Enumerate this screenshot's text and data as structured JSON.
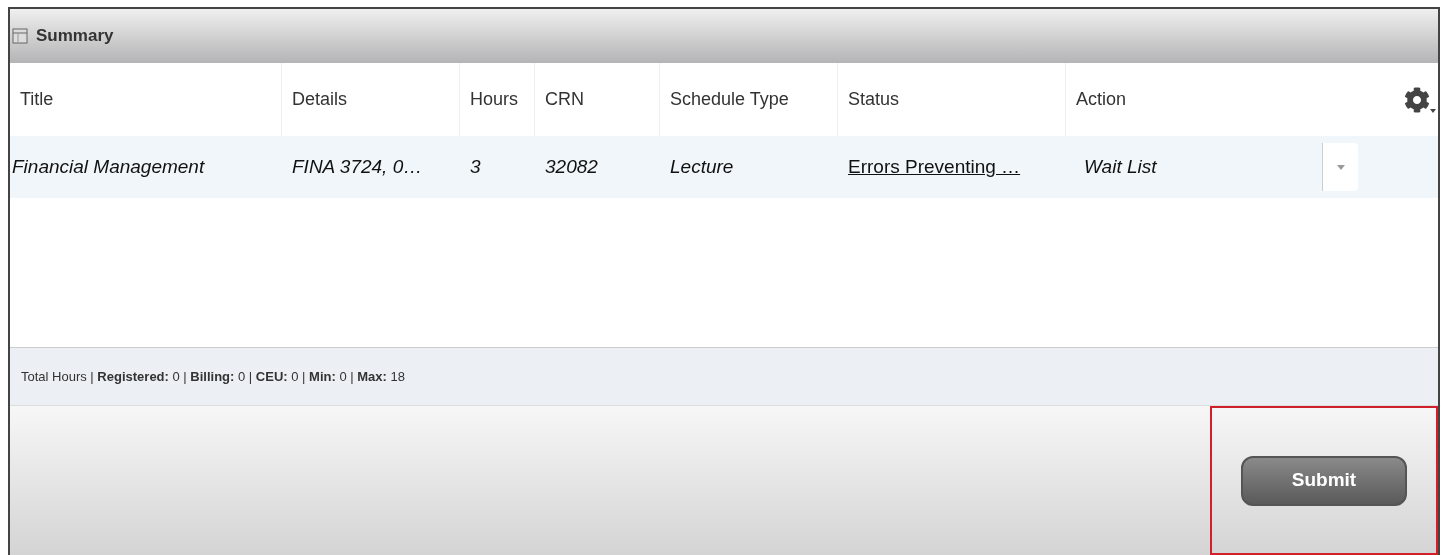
{
  "panel": {
    "title": "Summary"
  },
  "table": {
    "columns": [
      "Title",
      "Details",
      "Hours",
      "CRN",
      "Schedule Type",
      "Status",
      "Action"
    ],
    "rows": [
      {
        "title": "Financial Management",
        "details": "FINA 3724, 0…",
        "hours": "3",
        "crn": "32082",
        "schedule_type": "Lecture",
        "status": "Errors Preventing …",
        "action": "Wait List",
        "selected": true
      }
    ]
  },
  "footer": {
    "text": "Total Hours | **Registered:** 0 | **Billing:** 0 | **CEU:** 0 | **Min:** 0 | **Max:** 18"
  },
  "buttons": [
    {
      "label": "Submit",
      "highlighted": true
    }
  ]
}
